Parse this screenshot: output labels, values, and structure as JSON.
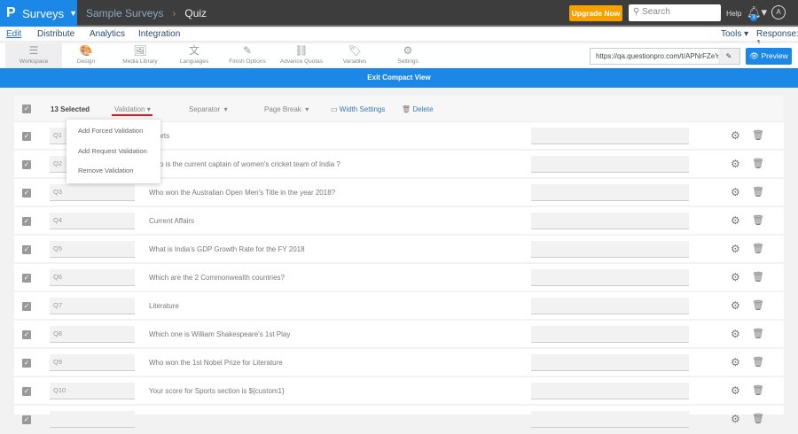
{
  "header": {
    "logo": "P",
    "app": "Surveys",
    "breadcrumb": [
      "Sample Surveys",
      "Quiz"
    ],
    "upgrade": "Upgrade Now",
    "search_placeholder": "Search",
    "help": "Help",
    "notifications": "3",
    "avatar": "A"
  },
  "nav": {
    "items": [
      "Edit",
      "Distribute",
      "Analytics",
      "Integration"
    ],
    "tools": "Tools ▾",
    "response": "Response: 1"
  },
  "toolbar": {
    "items": [
      {
        "label": "Workspace",
        "icon": "☰"
      },
      {
        "label": "Design",
        "icon": "🎨"
      },
      {
        "label": "Media Library",
        "icon": "🖼"
      },
      {
        "label": "Languages",
        "icon": "文"
      },
      {
        "label": "Finish Options",
        "icon": "✎"
      },
      {
        "label": "Advance Quotas",
        "icon": "⛓"
      },
      {
        "label": "Variables",
        "icon": "🏷"
      },
      {
        "label": "Settings",
        "icon": "⚙"
      }
    ],
    "url": "https://qa.questionpro.com/t/APNrFZeY",
    "preview": "👁 Preview"
  },
  "banner": "Exit Compact View",
  "bulk": {
    "selected": "13 Selected",
    "validation": "Validation",
    "separator": "Separator",
    "page_break": "Page Break",
    "width_settings": "Width Settings",
    "delete": "Delete"
  },
  "menu": [
    "Add Forced Validation",
    "Add Request Validation",
    "Remove Validation"
  ],
  "questions": [
    {
      "num": "Q1",
      "text": "Sports"
    },
    {
      "num": "Q2",
      "text": "Who is the current captain of women's cricket team of India ?"
    },
    {
      "num": "Q3",
      "text": "Who won the Australian Open Men's Title in the year 2018?"
    },
    {
      "num": "Q4",
      "text": "Current Affairs"
    },
    {
      "num": "Q5",
      "text": "What is India's GDP Growth Rate for the FY 2018"
    },
    {
      "num": "Q6",
      "text": "Which are the 2 Commonwealth countries?"
    },
    {
      "num": "Q7",
      "text": "Literature"
    },
    {
      "num": "Q8",
      "text": "Which one is William Shakespeare's 1st Play"
    },
    {
      "num": "Q9",
      "text": "Who won the 1st Nobel Prize for Literature"
    },
    {
      "num": "Q10",
      "text": "Your score for Sports section is ${custom1}"
    }
  ]
}
